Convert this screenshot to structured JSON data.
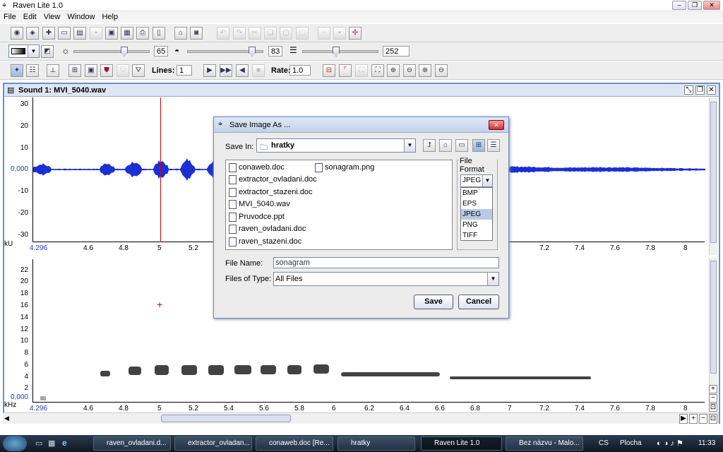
{
  "window": {
    "title": "Raven Lite 1.0",
    "logo_glyph": "⌖"
  },
  "menu": [
    "File",
    "Edit",
    "View",
    "Window",
    "Help"
  ],
  "toolbar2": {
    "brightness": "65",
    "contrast": "83",
    "resolution": "252"
  },
  "toolbar3": {
    "lines_label": "Lines:",
    "lines_value": "1",
    "rate_label": "Rate:",
    "rate_value": "1.0"
  },
  "panel": {
    "title": "Sound 1: MVI_5040.wav"
  },
  "waveform": {
    "y_ticks": [
      "30",
      "20",
      "10",
      "0,000",
      "-10",
      "-20",
      "-30"
    ],
    "y_unit": "kU",
    "x_start": "4.296",
    "x_ticks": [
      "4.6",
      "4.8",
      "5",
      "5.2",
      "7.2",
      "7.4",
      "7.6",
      "7.8",
      "8"
    ],
    "zero_color": "#1f3fbf",
    "wave_color": "#1a2fd6"
  },
  "spectrogram": {
    "y_ticks": [
      "22",
      "20",
      "18",
      "16",
      "14",
      "12",
      "10",
      "8",
      "6",
      "4",
      "2",
      "0,000"
    ],
    "y_unit": "kHz",
    "x_start": "4.296",
    "x_ticks": [
      "4.6",
      "4.8",
      "5",
      "5.2",
      "5.4",
      "5.6",
      "5.8",
      "6",
      "6.2",
      "6.4",
      "6.6",
      "6.8",
      "7",
      "7.2",
      "7.4",
      "7.6",
      "7.8",
      "8"
    ],
    "cursor_mark": "+"
  },
  "dialog": {
    "title": "Save Image As ...",
    "save_in_label": "Save In:",
    "save_in_value": "hratky",
    "files": [
      "conaweb.doc",
      "extractor_ovladani.doc",
      "extractor_stazeni.doc",
      "MVI_5040.wav",
      "Pruvodce.ppt",
      "raven_ovladani.doc",
      "raven_stazeni.doc",
      "sonagram.png"
    ],
    "file_format_label": "File Format",
    "format_selected": "JPEG",
    "formats": [
      "BMP",
      "EPS",
      "JPEG",
      "PNG",
      "TIFF"
    ],
    "file_name_label": "File Name:",
    "file_name_value": "sonagram",
    "files_of_type_label": "Files of Type:",
    "files_of_type_value": "All Files",
    "save_button": "Save",
    "cancel_button": "Cancel"
  },
  "taskbar": {
    "tasks": [
      "raven_ovladani.d...",
      "extractor_ovladan...",
      "conaweb.doc [Re...",
      "hratky",
      "Raven Lite 1.0",
      "Bez názvu - Malo..."
    ],
    "lang": "CS",
    "desktop": "Plocha",
    "time": "11:33"
  }
}
